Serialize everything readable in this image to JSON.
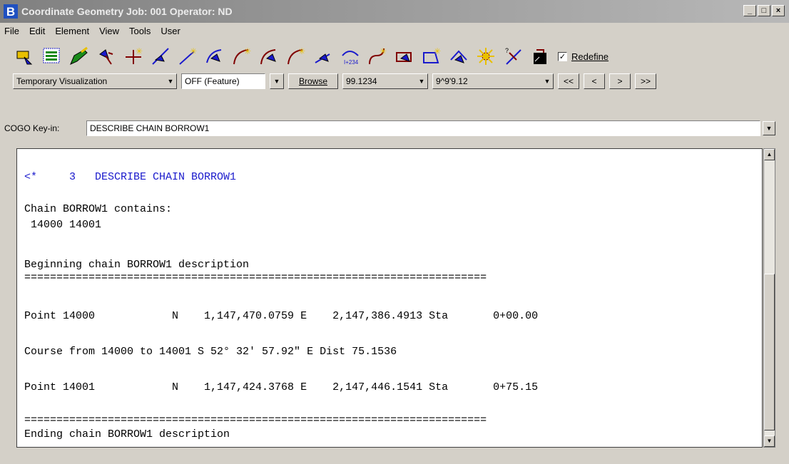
{
  "window": {
    "title": "Coordinate Geometry  Job: 001  Operator: ND",
    "minimize": "_",
    "maximize": "□",
    "close": "×"
  },
  "menu": {
    "items": [
      "File",
      "Edit",
      "Element",
      "View",
      "Tools",
      "User"
    ]
  },
  "toolbar": {
    "icons": [
      "store-point-icon",
      "select-elements-icon",
      "edit-element-icon",
      "locate-point-icon",
      "point-by-intersection-icon",
      "curve-icon",
      "line-icon",
      "arc-curve-icon",
      "curve-by-points-icon",
      "arc-point-icon",
      "reverse-curve-icon",
      "spiral-icon",
      "stationing-icon",
      "chain-icon",
      "curve-point-icon",
      "parcel-icon",
      "traverse-icon",
      "sun-icon",
      "intersect-icon",
      "terminal-icon"
    ],
    "redefine_label": "Redefine",
    "redefine_checked": "✓"
  },
  "toolbar2": {
    "visualization_mode": "Temporary Visualization",
    "visualization_state": "OFF (Feature)",
    "browse_label": "Browse",
    "distance_value": "99.1234",
    "angle_value": "9^9'9.12",
    "nav_first": "<<",
    "nav_prev": "<",
    "nav_next": ">",
    "nav_last": ">>"
  },
  "keyin": {
    "label": "COGO Key-in:",
    "value": "DESCRIBE CHAIN BORROW1"
  },
  "output": {
    "command_line": "<*     3   DESCRIBE CHAIN BORROW1",
    "line_contains": "Chain BORROW1 contains:",
    "line_points": " 14000 14001",
    "line_begin": "Beginning chain BORROW1 description",
    "separator1": "========================================================================",
    "line_point1": "Point 14000            N    1,147,470.0759 E    2,147,386.4913 Sta       0+00.00",
    "line_course": "Course from 14000 to 14001 S 52° 32' 57.92\" E Dist 75.1536",
    "line_point2": "Point 14001            N    1,147,424.3768 E    2,147,446.1541 Sta       0+75.15",
    "separator2": "========================================================================",
    "line_end": "Ending chain BORROW1 description"
  }
}
